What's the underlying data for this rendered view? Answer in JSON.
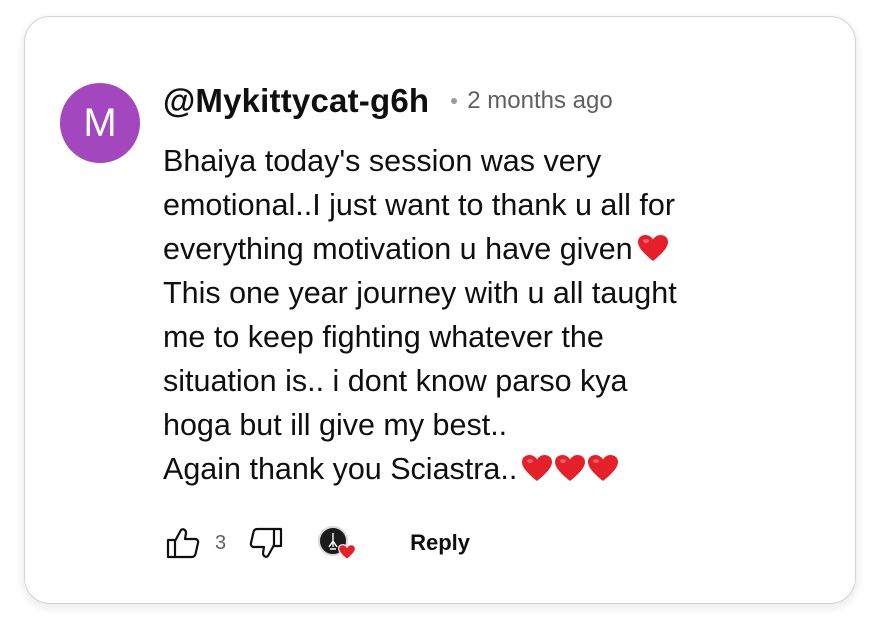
{
  "comment": {
    "avatar_letter": "M",
    "avatar_color": "#a247bd",
    "username": "@Mykittycat-g6h",
    "timestamp": "2 months ago",
    "body_lines": [
      "Bhaiya today's session was very",
      "emotional..I just want to thank u all for",
      "everything motivation u have given",
      "This one year journey with u all taught",
      "me to keep fighting whatever the",
      "situation is.. i dont know parso kya",
      "hoga but ill give my best..",
      "Again thank you Sciastra.."
    ],
    "heart_color": "#e4202b"
  },
  "actions": {
    "like_icon": "thumbs-up-icon",
    "like_count": "3",
    "dislike_icon": "thumbs-down-icon",
    "creator_heart_icon": "creator-heart-icon",
    "reply_label": "Reply"
  }
}
